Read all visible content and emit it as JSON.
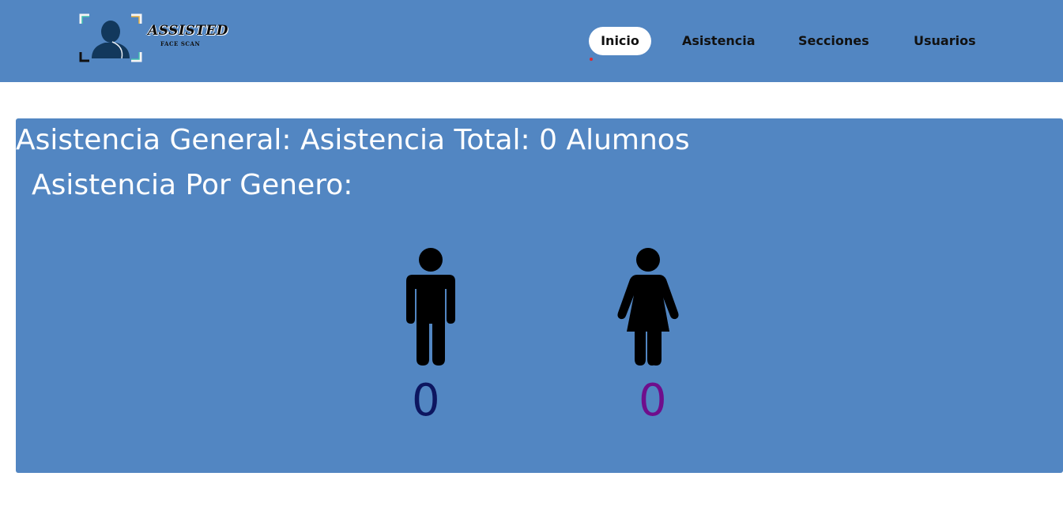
{
  "header": {
    "logo_title": "ASSISTED",
    "logo_subtitle": "FACE SCAN",
    "nav": [
      {
        "label": "Inicio",
        "active": true
      },
      {
        "label": "Asistencia",
        "active": false
      },
      {
        "label": "Secciones",
        "active": false
      },
      {
        "label": "Usuarios",
        "active": false
      }
    ]
  },
  "main": {
    "title": "Asistencia General: Asistencia Total: 0 Alumnos",
    "subtitle": "Asistencia Por Genero:",
    "male": {
      "icon": "male-person-icon",
      "count": "0",
      "color": "#0d1660"
    },
    "female": {
      "icon": "female-person-icon",
      "count": "0",
      "color": "#6f0e8c"
    }
  },
  "colors": {
    "header_bg": "#5286c2",
    "panel_bg": "#5286c2",
    "active_indicator": "#e0282d"
  }
}
